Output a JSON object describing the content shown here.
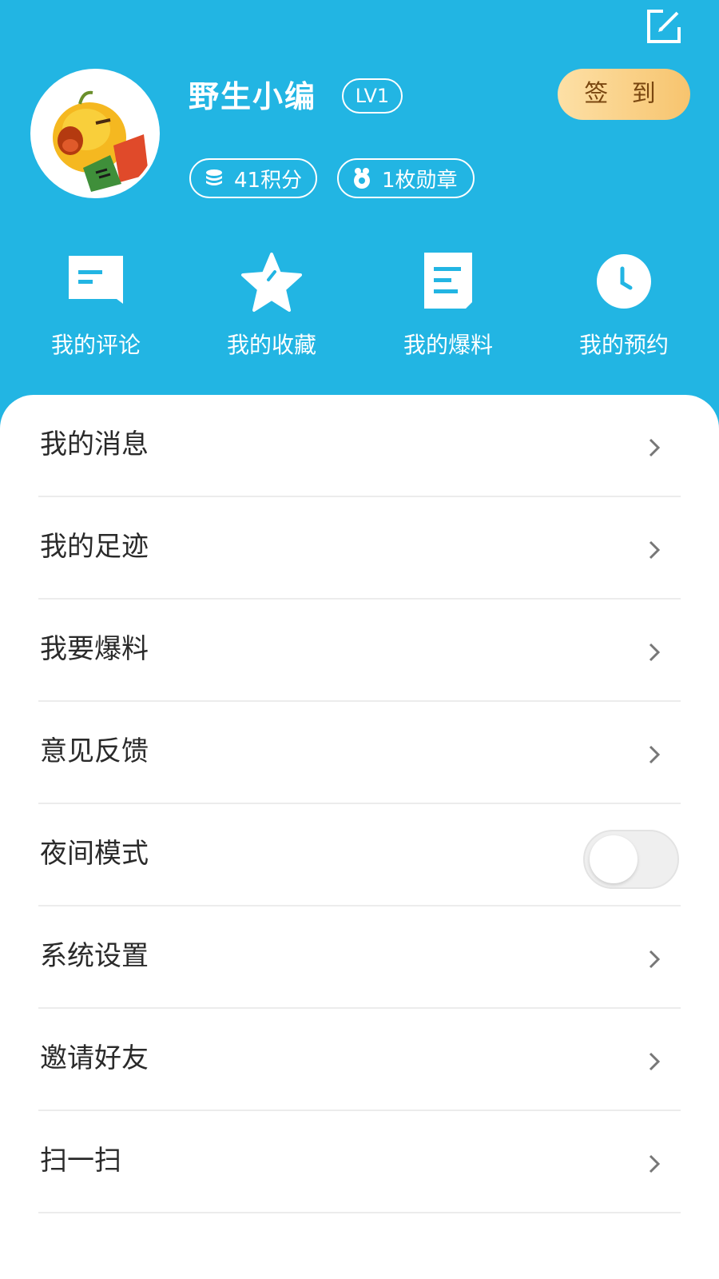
{
  "profile": {
    "username": "野生小编",
    "level": "LV1",
    "signin_label": "签 到",
    "points_label": "41积分",
    "medals_label": "1枚勋章"
  },
  "quick_nav": [
    {
      "label": "我的评论",
      "icon": "comment-icon"
    },
    {
      "label": "我的收藏",
      "icon": "star-icon"
    },
    {
      "label": "我的爆料",
      "icon": "document-icon"
    },
    {
      "label": "我的预约",
      "icon": "clock-icon"
    }
  ],
  "menu": [
    {
      "label": "我的消息",
      "type": "link"
    },
    {
      "label": "我的足迹",
      "type": "link"
    },
    {
      "label": "我要爆料",
      "type": "link"
    },
    {
      "label": "意见反馈",
      "type": "link"
    },
    {
      "label": "夜间模式",
      "type": "toggle",
      "on": false
    },
    {
      "label": "系统设置",
      "type": "link"
    },
    {
      "label": "邀请好友",
      "type": "link"
    },
    {
      "label": "扫一扫",
      "type": "link"
    }
  ],
  "colors": {
    "header_bg": "#22b5e3",
    "signin_gradient_start": "#fde0a6",
    "signin_gradient_end": "#f7c46e",
    "card_bg": "#ffffff"
  }
}
